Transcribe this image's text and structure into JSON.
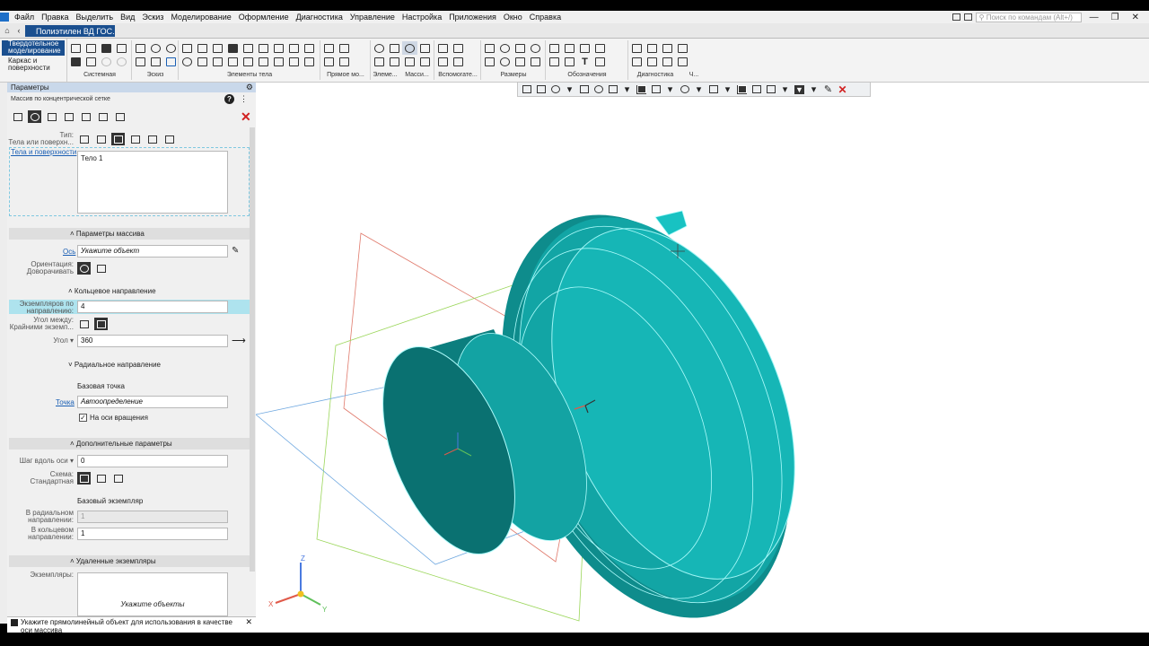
{
  "menu": {
    "items": [
      "Файл",
      "Правка",
      "Выделить",
      "Вид",
      "Эскиз",
      "Моделирование",
      "Оформление",
      "Диагностика",
      "Управление",
      "Настройка",
      "Приложения",
      "Окно",
      "Справка"
    ],
    "search_placeholder": "Поиск по командам (Alt+/)"
  },
  "document_tab": {
    "title": "Полиэтилен ВД ГОС..."
  },
  "ribbon": {
    "mode_solid": "Твердотельное моделирование",
    "mode_wire": "Каркас и поверхности",
    "groups": [
      "Системная",
      "Эскиз",
      "Элементы тела",
      "Прямое мо...",
      "Элеме...",
      "Масси...",
      "Вспомогате...",
      "Размеры",
      "Обозначения",
      "Диагностика",
      "Ч..."
    ]
  },
  "panel": {
    "title": "Параметры",
    "subtitle": "Массив по концентрической сетке",
    "type_label": "Тип:",
    "type_sub": "Тела или поверхн...",
    "bodies_link": "Тела и поверхности",
    "bodies_value": "Тело 1",
    "sec_array": "Параметры массива",
    "axis_link": "Ось",
    "axis_value": "Укажите объект",
    "orient_label": "Ориентация:",
    "orient_sub": "Доворачивать",
    "sec_ring": "Кольцевое направление",
    "count_label": "Экземпляров по направлению:",
    "count_value": "4",
    "angle_between_label": "Угол между:",
    "angle_between_sub": "Крайними экземп...",
    "angle_label": "Угол",
    "angle_value": "360",
    "sec_radial": "Радиальное направление",
    "base_point": "Базовая точка",
    "point_link": "Точка",
    "point_value": "Автоопределение",
    "on_axis_label": "На оси вращения",
    "sec_extra": "Дополнительные параметры",
    "step_label": "Шаг вдоль оси",
    "step_value": "0",
    "scheme_label": "Схема:",
    "scheme_sub": "Стандартная",
    "base_instance": "Базовый экземпляр",
    "radial_dir_label": "В радиальном направлении:",
    "radial_dir_value": "1",
    "ring_dir_label": "В кольцевом направлении:",
    "ring_dir_value": "1",
    "sec_removed": "Удаленные экземпляры",
    "instances_label": "Экземпляры:",
    "instances_placeholder": "Укажите объекты"
  },
  "status": {
    "text": "Укажите прямолинейный объект для использования в качестве оси массива"
  },
  "triad": {
    "x": "X",
    "y": "Y",
    "z": "Z"
  },
  "colors": {
    "model": "#16b8b8",
    "accent": "#1a4f8f",
    "highlight": "#aee3ee",
    "link": "#1a5fb4"
  }
}
